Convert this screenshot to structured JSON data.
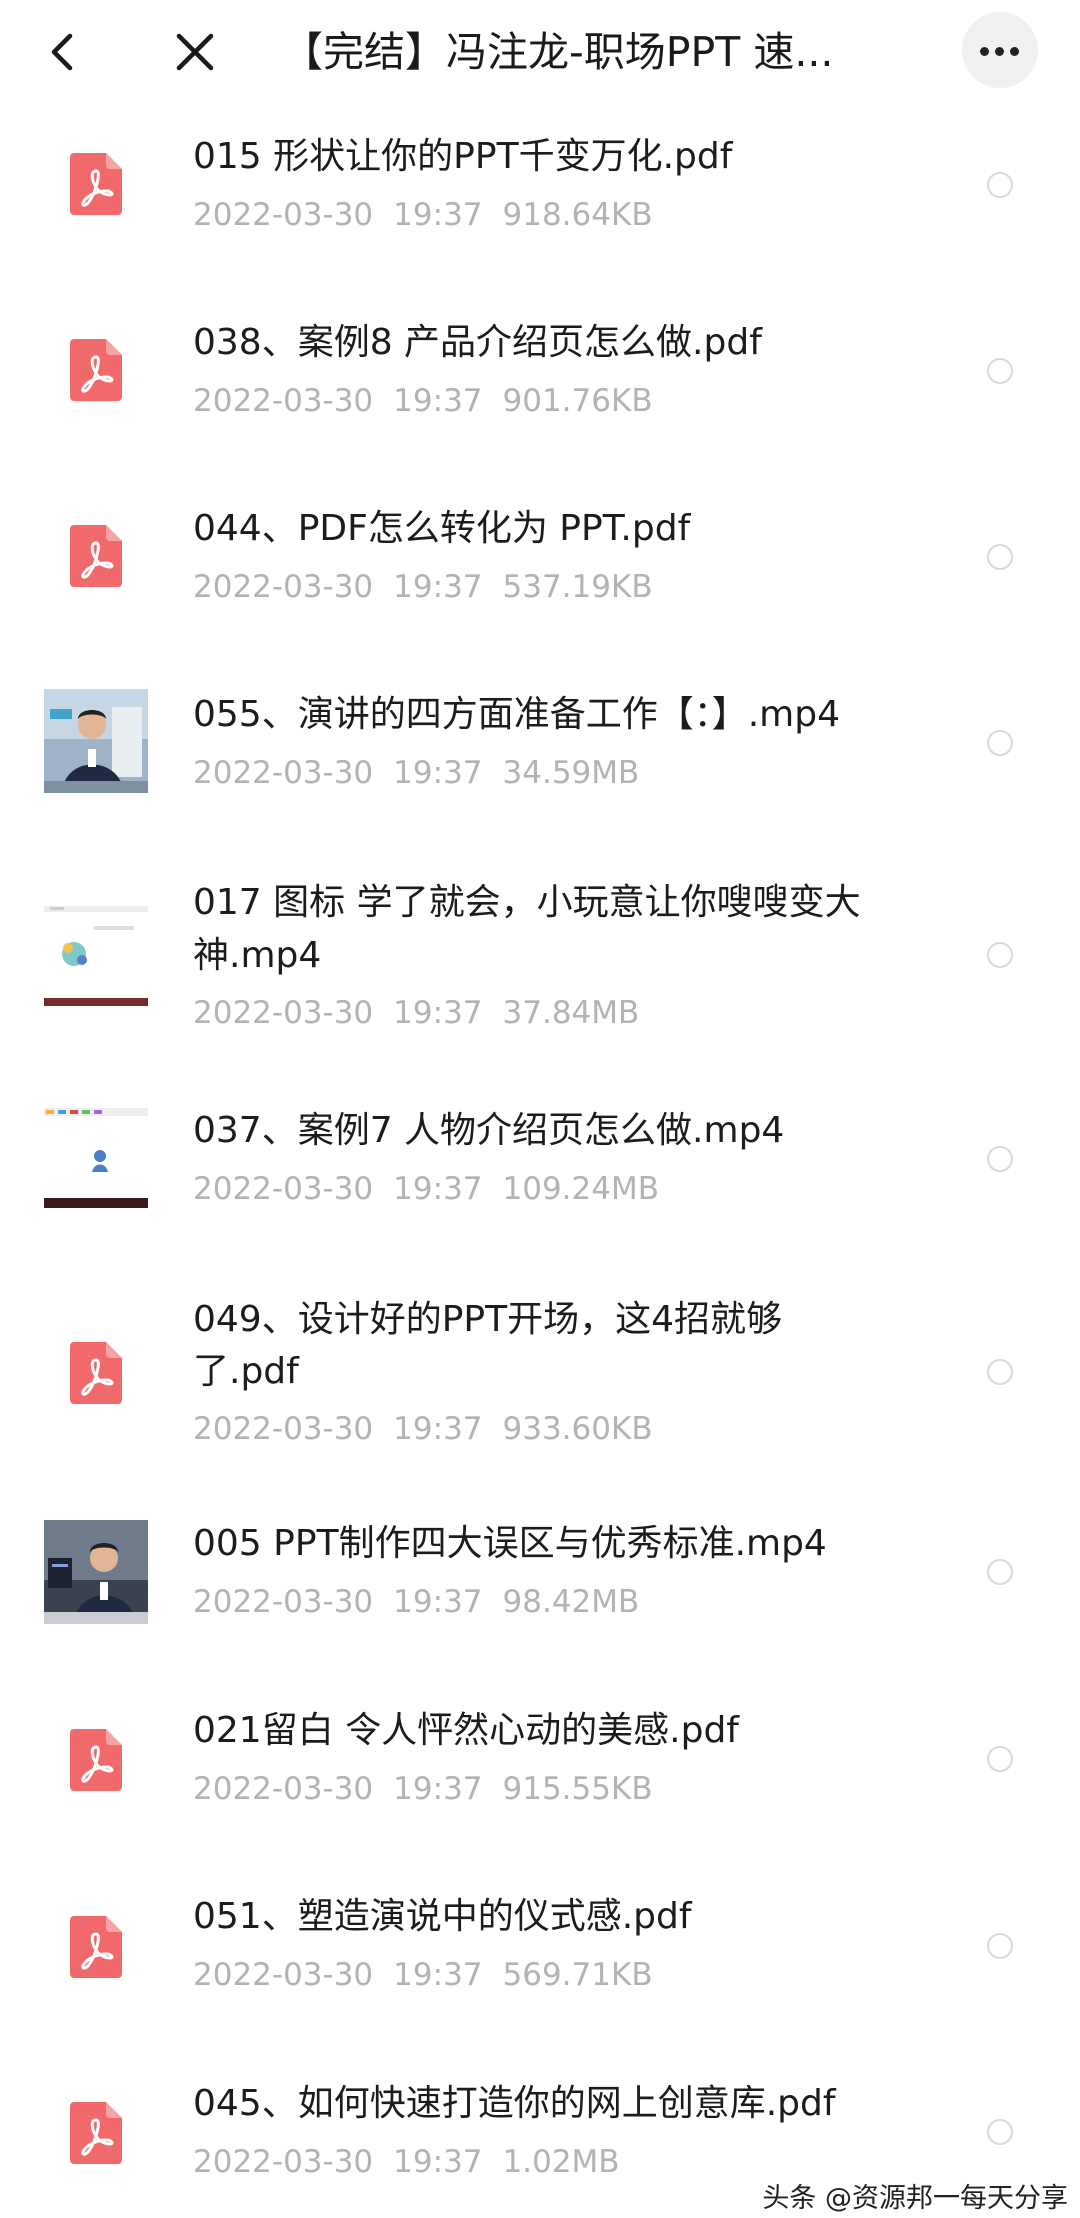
{
  "header": {
    "title": "【完结】冯注龙-职场PPT 速..."
  },
  "icons": {
    "back": "chevron-left-icon",
    "close": "close-icon",
    "more": "more-icon",
    "pdf": "pdf-icon",
    "video": "video-thumbnail"
  },
  "colors": {
    "pdf": "#f0696b",
    "meta": "#b3b3b3",
    "text": "#1c1c1c"
  },
  "files": [
    {
      "line1": "015 形状让你的PPT千变万化.pdf",
      "line2": "",
      "date": "2022-03-30",
      "time": "19:37",
      "size": "918.64KB",
      "type": "pdf"
    },
    {
      "line1": "038、案例8 产品介绍页怎么做.pdf",
      "line2": "",
      "date": "2022-03-30",
      "time": "19:37",
      "size": "901.76KB",
      "type": "pdf"
    },
    {
      "line1": "044、PDF怎么转化为 PPT.pdf",
      "line2": "",
      "date": "2022-03-30",
      "time": "19:37",
      "size": "537.19KB",
      "type": "pdf"
    },
    {
      "line1": "055、演讲的四方面准备工作【：】.mp4",
      "line2": "",
      "date": "2022-03-30",
      "time": "19:37",
      "size": "34.59MB",
      "type": "video-person"
    },
    {
      "line1": "017 图标 学了就会，小玩意让你嗖嗖变大",
      "line2": "神.mp4",
      "date": "2022-03-30",
      "time": "19:37",
      "size": "37.84MB",
      "type": "video-slide"
    },
    {
      "line1": "037、案例7 人物介绍页怎么做.mp4",
      "line2": "",
      "date": "2022-03-30",
      "time": "19:37",
      "size": "109.24MB",
      "type": "video-slide"
    },
    {
      "line1": "049、设计好的PPT开场，这4招就够",
      "line2": "了.pdf",
      "date": "2022-03-30",
      "time": "19:37",
      "size": "933.60KB",
      "type": "pdf"
    },
    {
      "line1": "005 PPT制作四大误区与优秀标准.mp4",
      "line2": "",
      "date": "2022-03-30",
      "time": "19:37",
      "size": "98.42MB",
      "type": "video-person"
    },
    {
      "line1": "021留白 令人怦然心动的美感.pdf",
      "line2": "",
      "date": "2022-03-30",
      "time": "19:37",
      "size": "915.55KB",
      "type": "pdf"
    },
    {
      "line1": "051、塑造演说中的仪式感.pdf",
      "line2": "",
      "date": "2022-03-30",
      "time": "19:37",
      "size": "569.71KB",
      "type": "pdf"
    },
    {
      "line1": "045、如何快速打造你的网上创意库.pdf",
      "line2": "",
      "date": "2022-03-30",
      "time": "19:37",
      "size": "1.02MB",
      "type": "pdf"
    }
  ],
  "watermark": "头条 @资源邦一每天分享"
}
